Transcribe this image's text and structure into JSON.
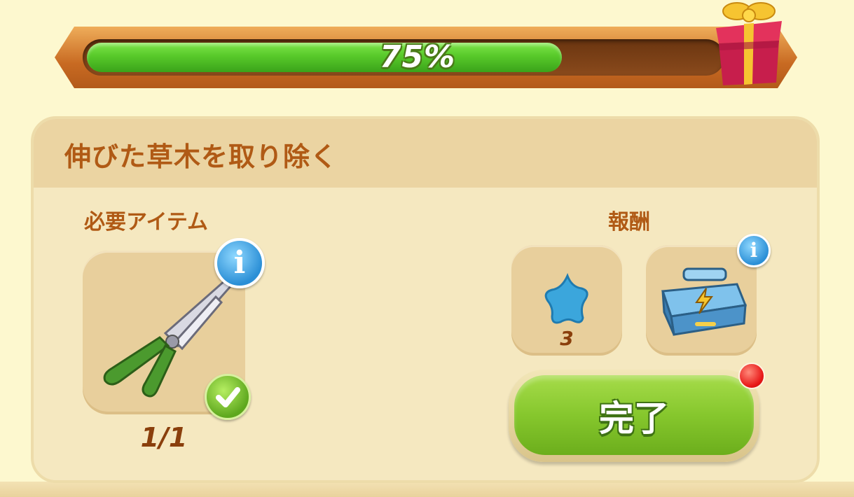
{
  "progress": {
    "percent": 0.75,
    "label": "75%"
  },
  "quest": {
    "title": "伸びた草木を取り除く",
    "required_label": "必要アイテム",
    "reward_label": "報酬",
    "required_item": {
      "icon": "pruning-shears-icon",
      "count": "1/1",
      "completed": true
    },
    "rewards": [
      {
        "icon": "blue-star-icon",
        "count": "3"
      },
      {
        "icon": "energy-toolbox-icon",
        "has_info": true
      }
    ],
    "complete_button": "完了"
  },
  "colors": {
    "title_text": "#b05a15",
    "progress_fill": "#58c92a",
    "button_green": "#86c72d",
    "notification": "#e81818"
  }
}
